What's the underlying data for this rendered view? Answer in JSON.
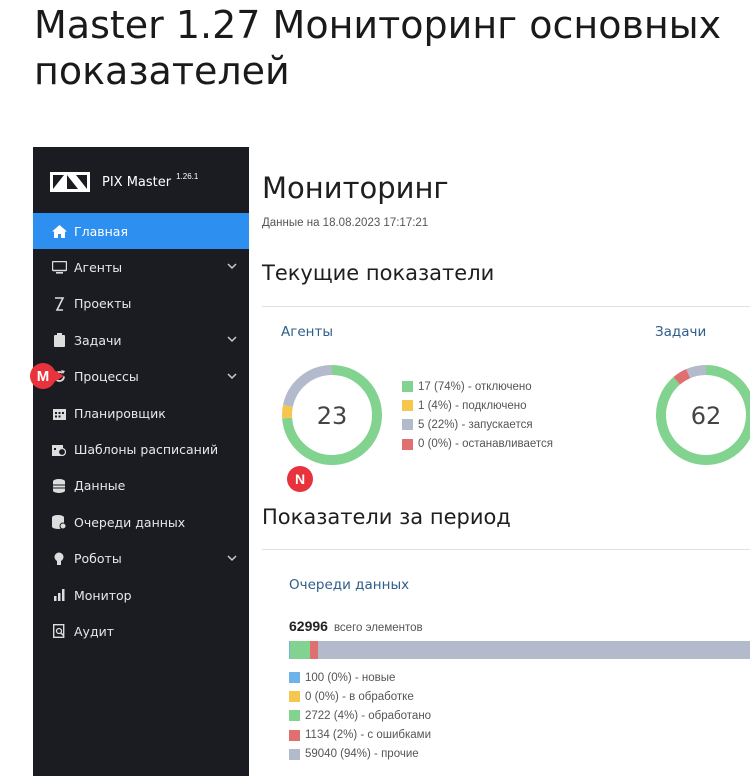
{
  "page_heading": "Master 1.27 Мониторинг основных показателей",
  "markers": {
    "m": "M",
    "n": "N"
  },
  "app": {
    "brand": {
      "name": "PIX Master",
      "version": "1.26.1"
    },
    "nav": [
      {
        "label": "Главная",
        "icon": "home-icon",
        "active": true,
        "has_children": false
      },
      {
        "label": "Агенты",
        "icon": "monitor-icon",
        "active": false,
        "has_children": true
      },
      {
        "label": "Проекты",
        "icon": "project-icon",
        "active": false,
        "has_children": false
      },
      {
        "label": "Задачи",
        "icon": "clipboard-icon",
        "active": false,
        "has_children": true
      },
      {
        "label": "Процессы",
        "icon": "refresh-icon",
        "active": false,
        "has_children": true
      },
      {
        "label": "Планировщик",
        "icon": "calendar-icon",
        "active": false,
        "has_children": false
      },
      {
        "label": "Шаблоны расписаний",
        "icon": "calendar-clock-icon",
        "active": false,
        "has_children": false
      },
      {
        "label": "Данные",
        "icon": "database-icon",
        "active": false,
        "has_children": false
      },
      {
        "label": "Очереди данных",
        "icon": "queue-database-icon",
        "active": false,
        "has_children": false
      },
      {
        "label": "Роботы",
        "icon": "robot-icon",
        "active": false,
        "has_children": true
      },
      {
        "label": "Монитор",
        "icon": "bar-chart-icon",
        "active": false,
        "has_children": false
      },
      {
        "label": "Аудит",
        "icon": "audit-icon",
        "active": false,
        "has_children": false
      }
    ],
    "main": {
      "title": "Мониторинг",
      "timestamp": "Данные на 18.08.2023 17:17:21",
      "current_section": "Текущие показатели",
      "agents": {
        "title": "Агенты",
        "total": "23",
        "legend": [
          "17 (74%) - отключено",
          "1 (4%) - подключено",
          "5 (22%) - запускается",
          "0 (0%) - останавливается"
        ]
      },
      "tasks": {
        "title": "Задачи",
        "total": "62"
      },
      "period_section": "Показатели за период",
      "queues": {
        "title": "Очереди данных",
        "total": "62996",
        "total_label": "всего элементов",
        "legend": [
          "100 (0%) - новые",
          "0 (0%) - в обработке",
          "2722 (4%) - обработано",
          "1134 (2%) - с ошибками",
          "59040 (94%) - прочие"
        ]
      }
    }
  },
  "colors": {
    "sidebar_bg": "#1a1c22",
    "active_bg": "#2d8ff0",
    "green": "#82d38f",
    "yellow": "#f7c74d",
    "gray": "#b3bacb",
    "red": "#e07070",
    "blue": "#6fb2e8",
    "marker": "#e8323c"
  },
  "chart_data": [
    {
      "type": "pie",
      "title": "Агенты",
      "categories": [
        "отключено",
        "подключено",
        "запускается",
        "останавливается"
      ],
      "values": [
        17,
        1,
        5,
        0
      ]
    },
    {
      "type": "pie",
      "title": "Задачи",
      "categories": [
        "green",
        "red",
        "gray"
      ],
      "values": [
        55,
        3,
        4
      ]
    },
    {
      "type": "bar",
      "title": "Очереди данных",
      "categories": [
        "новые",
        "в обработке",
        "обработано",
        "с ошибками",
        "прочие"
      ],
      "values": [
        100,
        0,
        2722,
        1134,
        59040
      ]
    }
  ]
}
